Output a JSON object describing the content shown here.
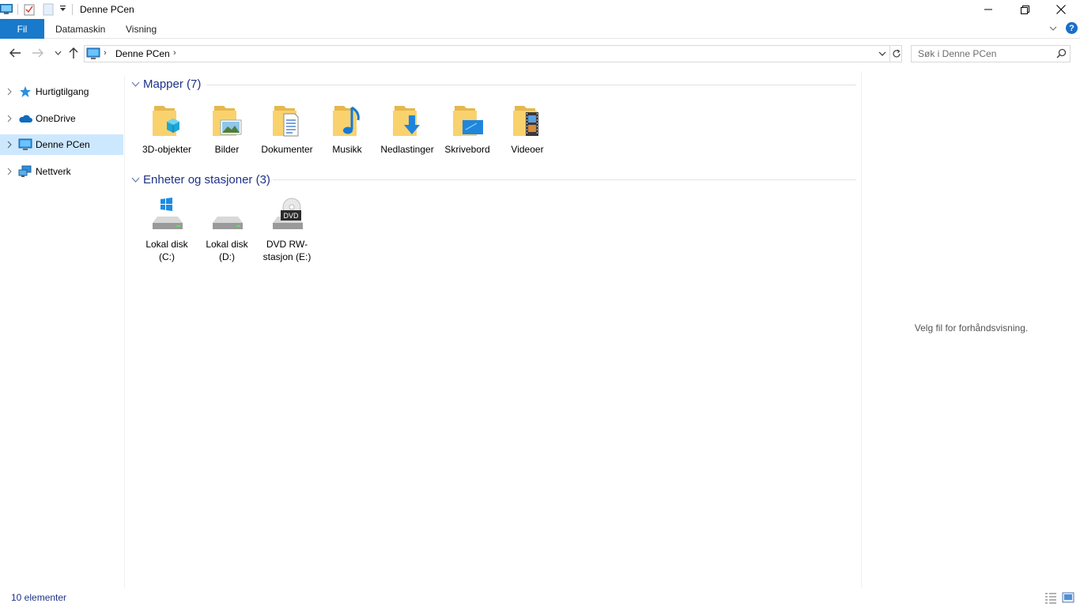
{
  "window": {
    "title": "Denne PCen",
    "minimize_icon": "minimize-icon",
    "maximize_icon": "restore-icon",
    "close_icon": "close-icon"
  },
  "ribbon": {
    "tabs": [
      {
        "label": "Fil",
        "active": true
      },
      {
        "label": "Datamaskin"
      },
      {
        "label": "Visning"
      }
    ],
    "help_label": "?",
    "accent_color": "#1979ca"
  },
  "navigation": {
    "address_path": "Denne PCen",
    "search_placeholder": "Søk i Denne PCen"
  },
  "navpane": {
    "items": [
      {
        "label": "Hurtigtilgang",
        "icon": "star-icon",
        "selected": false
      },
      {
        "label": "OneDrive",
        "icon": "cloud-icon",
        "selected": false
      },
      {
        "label": "Denne PCen",
        "icon": "computer-icon",
        "selected": true
      },
      {
        "label": "Nettverk",
        "icon": "network-icon",
        "selected": false
      }
    ]
  },
  "content": {
    "groups": [
      {
        "title": "Mapper (7)",
        "items": [
          {
            "label": "3D-objekter",
            "icon": "3d-objects-folder-icon"
          },
          {
            "label": "Bilder",
            "icon": "pictures-folder-icon"
          },
          {
            "label": "Dokumenter",
            "icon": "documents-folder-icon"
          },
          {
            "label": "Musikk",
            "icon": "music-folder-icon"
          },
          {
            "label": "Nedlastinger",
            "icon": "downloads-folder-icon"
          },
          {
            "label": "Skrivebord",
            "icon": "desktop-folder-icon"
          },
          {
            "label": "Videoer",
            "icon": "videos-folder-icon"
          }
        ]
      },
      {
        "title": "Enheter og stasjoner (3)",
        "items": [
          {
            "label": "Lokal disk (C:)",
            "icon": "windows-drive-icon"
          },
          {
            "label": "Lokal disk (D:)",
            "icon": "hard-drive-icon"
          },
          {
            "label": "DVD RW-stasjon (E:)",
            "icon": "dvd-drive-icon",
            "badge": "DVD"
          }
        ]
      }
    ]
  },
  "preview": {
    "message": "Velg fil for forhåndsvisning."
  },
  "status": {
    "item_count": "10 elementer"
  }
}
